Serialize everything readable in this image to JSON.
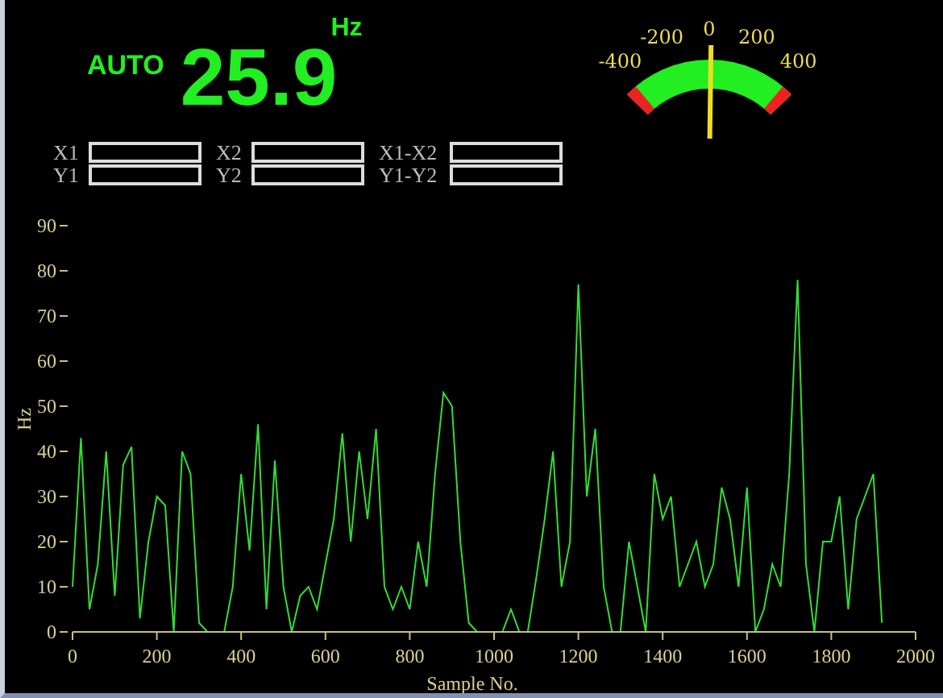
{
  "readout": {
    "mode": "AUTO",
    "value": "25.9",
    "unit": "Hz"
  },
  "gauge": {
    "labels": [
      "-400",
      "-200",
      "0",
      "200",
      "400"
    ],
    "level": 0.51
  },
  "cursors": [
    {
      "label": "X1"
    },
    {
      "label": "X2"
    },
    {
      "label": "X1-X2"
    },
    {
      "label": "Y1"
    },
    {
      "label": "Y2"
    },
    {
      "label": "Y1-Y2"
    }
  ],
  "chart_data": {
    "type": "line",
    "xlabel": "Sample No.",
    "ylabel": "Hz",
    "xlim": [
      0,
      2000
    ],
    "ylim": [
      0,
      90
    ],
    "xticks": [
      0,
      200,
      400,
      600,
      800,
      1000,
      1200,
      1400,
      1600,
      1800,
      2000
    ],
    "yticks": [
      0,
      10,
      20,
      30,
      40,
      50,
      60,
      70,
      80,
      90
    ],
    "x": [
      0,
      20,
      40,
      60,
      80,
      100,
      120,
      140,
      160,
      180,
      200,
      220,
      240,
      260,
      280,
      300,
      320,
      340,
      360,
      380,
      400,
      420,
      440,
      460,
      480,
      500,
      520,
      540,
      560,
      580,
      600,
      620,
      640,
      660,
      680,
      700,
      720,
      740,
      760,
      780,
      800,
      820,
      840,
      860,
      880,
      900,
      920,
      940,
      960,
      980,
      1000,
      1020,
      1040,
      1060,
      1080,
      1100,
      1120,
      1140,
      1160,
      1180,
      1200,
      1220,
      1240,
      1260,
      1280,
      1300,
      1320,
      1340,
      1360,
      1380,
      1400,
      1420,
      1440,
      1460,
      1480,
      1500,
      1520,
      1540,
      1560,
      1580,
      1600,
      1620,
      1640,
      1660,
      1680,
      1700,
      1720,
      1740,
      1760,
      1780,
      1800,
      1820,
      1840,
      1860,
      1880,
      1900,
      1920
    ],
    "series": [
      {
        "color": "#33dd33",
        "values": [
          10,
          43,
          5,
          15,
          40,
          8,
          37,
          41,
          3,
          20,
          30,
          28,
          0,
          40,
          35,
          2,
          0,
          0,
          0,
          10,
          35,
          18,
          46,
          5,
          38,
          10,
          0,
          8,
          10,
          5,
          15,
          25,
          44,
          20,
          40,
          25,
          45,
          10,
          5,
          10,
          5,
          20,
          10,
          35,
          53,
          50,
          20,
          2,
          0,
          0,
          0,
          0,
          5,
          0,
          0,
          12,
          25,
          40,
          10,
          20,
          77,
          30,
          45,
          10,
          0,
          0,
          20,
          10,
          0,
          35,
          25,
          30,
          10,
          15,
          20,
          10,
          15,
          32,
          25,
          10,
          32,
          0,
          5,
          15,
          10,
          35,
          78,
          15,
          0,
          20,
          20,
          30,
          5,
          25,
          30,
          35,
          2
        ]
      }
    ]
  }
}
